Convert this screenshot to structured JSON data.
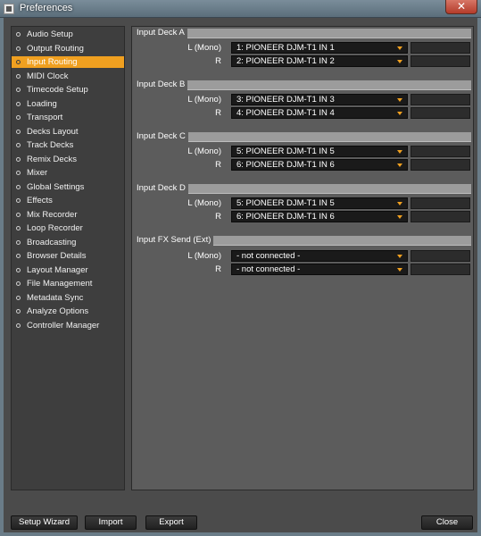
{
  "window": {
    "title": "Preferences",
    "close_label": "✕"
  },
  "sidebar": {
    "items": [
      {
        "label": "Audio Setup",
        "active": false
      },
      {
        "label": "Output Routing",
        "active": false
      },
      {
        "label": "Input Routing",
        "active": true
      },
      {
        "label": "MIDI Clock",
        "active": false
      },
      {
        "label": "Timecode Setup",
        "active": false
      },
      {
        "label": "Loading",
        "active": false
      },
      {
        "label": "Transport",
        "active": false
      },
      {
        "label": "Decks Layout",
        "active": false
      },
      {
        "label": "Track Decks",
        "active": false
      },
      {
        "label": "Remix Decks",
        "active": false
      },
      {
        "label": "Mixer",
        "active": false
      },
      {
        "label": "Global Settings",
        "active": false
      },
      {
        "label": "Effects",
        "active": false
      },
      {
        "label": "Mix Recorder",
        "active": false
      },
      {
        "label": "Loop Recorder",
        "active": false
      },
      {
        "label": "Broadcasting",
        "active": false
      },
      {
        "label": "Browser Details",
        "active": false
      },
      {
        "label": "Layout Manager",
        "active": false
      },
      {
        "label": "File Management",
        "active": false
      },
      {
        "label": "Metadata Sync",
        "active": false
      },
      {
        "label": "Analyze Options",
        "active": false
      },
      {
        "label": "Controller Manager",
        "active": false
      }
    ]
  },
  "sections": [
    {
      "title": "Input Deck A",
      "rows": [
        {
          "channel": "L (Mono)",
          "value": "1: PIONEER DJM-T1 IN 1"
        },
        {
          "channel": "R",
          "value": "2: PIONEER DJM-T1 IN 2"
        }
      ]
    },
    {
      "title": "Input Deck B",
      "rows": [
        {
          "channel": "L (Mono)",
          "value": "3: PIONEER DJM-T1 IN 3"
        },
        {
          "channel": "R",
          "value": "4: PIONEER DJM-T1 IN 4"
        }
      ]
    },
    {
      "title": "Input Deck C",
      "rows": [
        {
          "channel": "L (Mono)",
          "value": "5: PIONEER DJM-T1 IN 5"
        },
        {
          "channel": "R",
          "value": "6: PIONEER DJM-T1 IN 6"
        }
      ]
    },
    {
      "title": "Input Deck D",
      "rows": [
        {
          "channel": "L (Mono)",
          "value": "5: PIONEER DJM-T1 IN 5"
        },
        {
          "channel": "R",
          "value": "6: PIONEER DJM-T1 IN 6"
        }
      ]
    },
    {
      "title": "Input FX Send (Ext)",
      "rows": [
        {
          "channel": "L (Mono)",
          "value": "- not connected -"
        },
        {
          "channel": "R",
          "value": "- not connected -"
        }
      ]
    }
  ],
  "footer": {
    "setup_wizard_label": "Setup Wizard",
    "import_label": "Import",
    "export_label": "Export",
    "close_label": "Close"
  },
  "colors": {
    "accent": "#f0a020",
    "panel": "#5c5c5c",
    "sidebar": "#3e3e3e"
  }
}
